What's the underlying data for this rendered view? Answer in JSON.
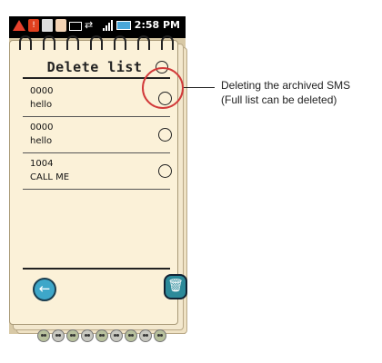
{
  "status_bar": {
    "time": "2:58 PM",
    "icons": [
      "warning-icon",
      "notification-icon",
      "sim-icon",
      "contact-icon",
      "mail-icon",
      "usb-icon",
      "signal-icon",
      "battery-icon"
    ]
  },
  "screen": {
    "title": "Delete list",
    "messages": [
      {
        "number": "0000",
        "text": "hello"
      },
      {
        "number": "0000",
        "text": "hello"
      },
      {
        "number": "1004",
        "text": "CALL ME"
      }
    ],
    "back_icon": "←",
    "trash_icon": "🗑"
  },
  "callout": {
    "line1": "Deleting the archived SMS",
    "line2": "(Full list can be deleted)"
  },
  "colors": {
    "paper": "#fbf1d8",
    "highlight": "#d23a3a",
    "back_button": "#3ea7c9",
    "trash_button": "#2c8a9a"
  }
}
